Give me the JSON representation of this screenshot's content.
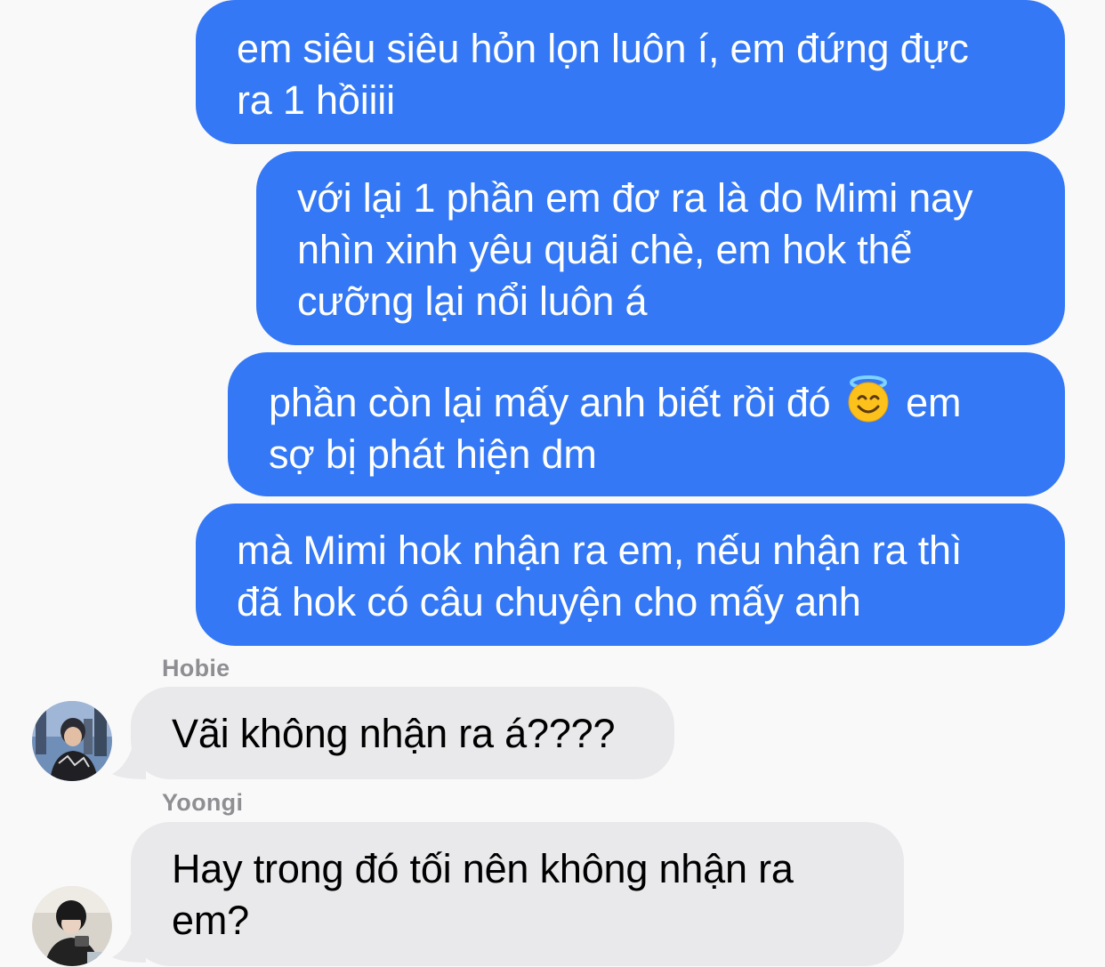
{
  "colors": {
    "outgoing_bubble": "#3478f6",
    "incoming_bubble": "#e9e9eb",
    "background": "#f9f9f9",
    "sender_name": "#8e8e93"
  },
  "messages": [
    {
      "direction": "outgoing",
      "lines": [
        "em siêu siêu hỏn lọn luôn í, em đứng đực",
        "ra 1 hồiiii"
      ]
    },
    {
      "direction": "outgoing",
      "lines": [
        "với lại 1 phần em đơ ra là do Mimi nay",
        "nhìn xinh yêu quãi chè, em hok thể",
        "cưỡng lại nổi luôn á"
      ]
    },
    {
      "direction": "outgoing",
      "line1_before_emoji": "phần còn lại mấy anh biết rồi đó",
      "emoji": "smiling-face-with-halo-emoji",
      "line1_after_emoji": "em",
      "line2": "sợ bị phát hiện dm"
    },
    {
      "direction": "outgoing",
      "lines": [
        "mà Mimi hok nhận ra em, nếu nhận ra thì",
        "đã hok có câu chuyện cho mấy anh"
      ]
    },
    {
      "direction": "incoming",
      "sender": "Hobie",
      "lines": [
        "Vãi không nhận ra á????"
      ]
    },
    {
      "direction": "incoming",
      "sender": "Yoongi",
      "lines": [
        "Hay trong đó tối nên không nhận ra",
        "em?"
      ]
    }
  ]
}
